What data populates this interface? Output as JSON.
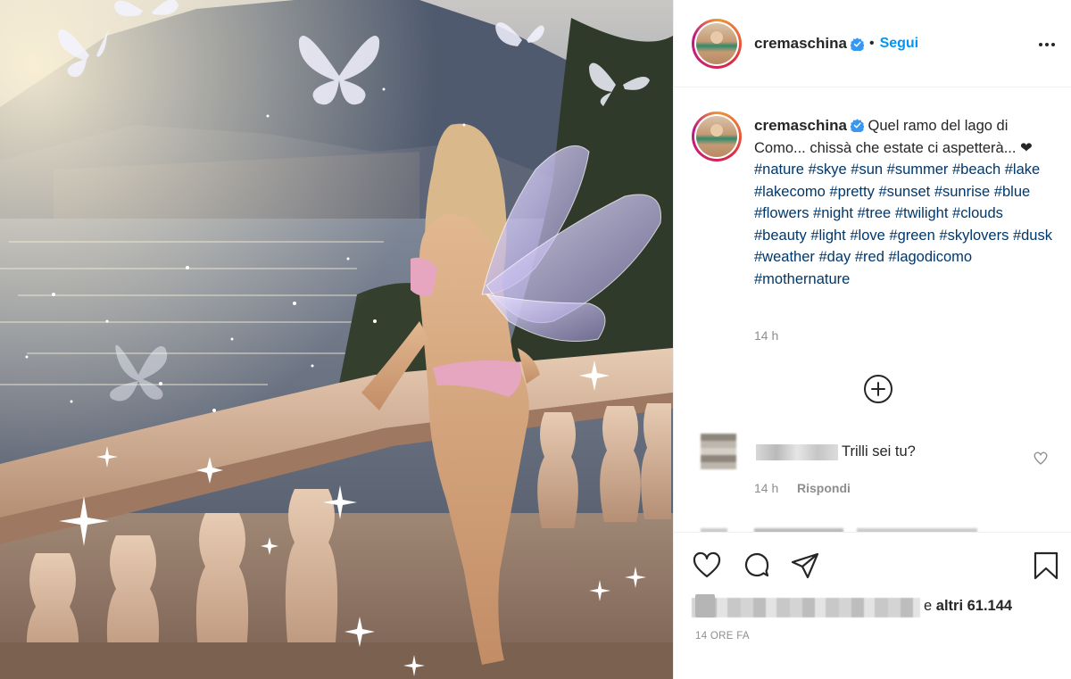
{
  "post": {
    "username": "cremaschina",
    "follow_label": "Segui",
    "separator": "•",
    "caption_text": "Quel ramo del lago di Como... chissà che estate ci aspetterà... ❤",
    "hashtags": [
      "#nature",
      "#skye",
      "#sun",
      "#summer",
      "#beach",
      "#lake",
      "#lakecomo",
      "#pretty",
      "#sunset",
      "#sunrise",
      "#blue",
      "#flowers",
      "#night",
      "#tree",
      "#twilight",
      "#clouds",
      "#beauty",
      "#light",
      "#love",
      "#green",
      "#skylovers",
      "#dusk",
      "#weather",
      "#day",
      "#red",
      "#lagodicomo",
      "#mothernature"
    ],
    "caption_time": "14 h",
    "timestamp": "14 ORE FA"
  },
  "comments": [
    {
      "text": "Trilli sei tu?",
      "time": "14 h",
      "reply_label": "Rispondi"
    }
  ],
  "likes": {
    "prefix": "e ",
    "others_label": "altri 61.144"
  },
  "icons": {
    "more": "more-options-icon",
    "verified": "verified-badge-icon",
    "load_more": "add-circle-icon",
    "like": "heart-icon",
    "comment": "comment-icon",
    "share": "paper-plane-icon",
    "save": "bookmark-icon"
  },
  "colors": {
    "accent": "#0095f6",
    "hashtag": "#00376b",
    "muted": "#8e8e8e",
    "text": "#262626"
  }
}
